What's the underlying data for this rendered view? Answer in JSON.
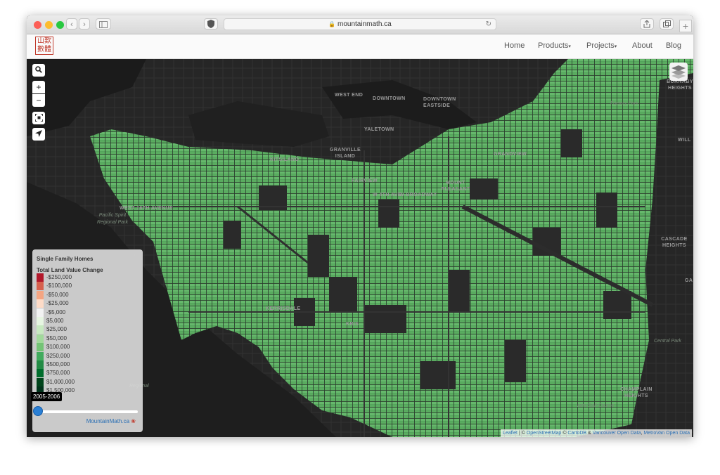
{
  "browser": {
    "url": "mountainmath.ca",
    "colors": {
      "close": "#fc5f57",
      "minimize": "#fdbc2e",
      "maximize": "#28c840"
    }
  },
  "site": {
    "logo_text": "山歎數體",
    "nav": [
      {
        "label": "Home",
        "dropdown": false
      },
      {
        "label": "Products",
        "dropdown": true
      },
      {
        "label": "Projects",
        "dropdown": true
      },
      {
        "label": "About",
        "dropdown": false
      },
      {
        "label": "Blog",
        "dropdown": false
      }
    ]
  },
  "map": {
    "controls": [
      {
        "name": "search-icon"
      },
      {
        "name": "zoom-in-icon",
        "glyph": "+"
      },
      {
        "name": "zoom-out-icon",
        "glyph": "−"
      },
      {
        "name": "fullscreen-icon"
      },
      {
        "name": "locate-icon"
      }
    ],
    "layers_icon": "layers-icon",
    "labels": {
      "places": [
        "WEST END",
        "DOWNTOWN",
        "DOWNTOWN EASTSIDE",
        "YALETOWN",
        "GRANVILLE ISLAND",
        "KITSILANO",
        "FAIRVIEW",
        "W 4TH AVE",
        "W BROADWAY",
        "WEST 16TH AVENUE",
        "MOUNT PLEASANT",
        "GRANDVIEW",
        "KERRISDALE",
        "KRIS",
        "CASCADE HEIGHTS",
        "BURNABY HEIGHTS",
        "CHAMPLAIN HEIGHTS",
        "WILL",
        "GA"
      ],
      "parks": [
        "Pacific Spirit Regional Park",
        "Central Park",
        "view Golf Course",
        "Regional",
        "Factory Park"
      ]
    },
    "legend": {
      "title": "Single Family Homes",
      "subtitle": "Total Land Value Change",
      "items": [
        {
          "label": "-$250,000",
          "color": "#b2182b"
        },
        {
          "label": "-$100,000",
          "color": "#d6604d"
        },
        {
          "label": "-$50,000",
          "color": "#f4a582"
        },
        {
          "label": "-$25,000",
          "color": "#fddbc7"
        },
        {
          "label": "-$5,000",
          "color": "#f2f2f2"
        },
        {
          "label": "$5,000",
          "color": "#e6f5e1"
        },
        {
          "label": "$25,000",
          "color": "#c7e9c0"
        },
        {
          "label": "$50,000",
          "color": "#a1d99b"
        },
        {
          "label": "$100,000",
          "color": "#74c476"
        },
        {
          "label": "$250,000",
          "color": "#41ab5d"
        },
        {
          "label": "$500,000",
          "color": "#238b45"
        },
        {
          "label": "$750,000",
          "color": "#006d2c"
        },
        {
          "label": "$1,000,000",
          "color": "#00441b"
        },
        {
          "label": "$1,500,000",
          "color": "#00331a"
        }
      ],
      "slider_value_label": "2005-2006",
      "slider_position": 0,
      "credit": "MountainMath.ca"
    },
    "attribution": {
      "parts": [
        "Leaflet",
        " | © ",
        "OpenStreetMap",
        " © ",
        "CartoDB",
        " & ",
        "Vancouver Open Data",
        ", ",
        "MetroVan Open Data"
      ]
    }
  }
}
